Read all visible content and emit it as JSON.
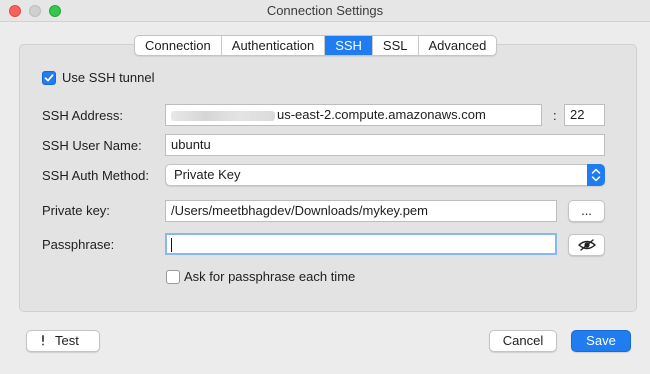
{
  "window": {
    "title": "Connection Settings"
  },
  "tabs": [
    {
      "label": "Connection",
      "active": false
    },
    {
      "label": "Authentication",
      "active": false
    },
    {
      "label": "SSH",
      "active": true
    },
    {
      "label": "SSL",
      "active": false
    },
    {
      "label": "Advanced",
      "active": false
    }
  ],
  "ssh": {
    "use_tunnel_label": "Use SSH tunnel",
    "use_tunnel_checked": true,
    "address_label": "SSH Address:",
    "address_value": "us-east-2.compute.amazonaws.com",
    "port_separator": ":",
    "port_value": "22",
    "username_label": "SSH User Name:",
    "username_value": "ubuntu",
    "auth_method_label": "SSH Auth Method:",
    "auth_method_value": "Private Key",
    "private_key_label": "Private key:",
    "private_key_value": "/Users/meetbhagdev/Downloads/mykey.pem",
    "browse_label": "...",
    "passphrase_label": "Passphrase:",
    "passphrase_value": "",
    "ask_passphrase_label": "Ask for passphrase each time",
    "ask_passphrase_checked": false
  },
  "footer": {
    "test_label": "Test",
    "cancel_label": "Cancel",
    "save_label": "Save"
  },
  "icons": {
    "test": "exclamation-icon",
    "passphrase_toggle": "eye-slash-icon",
    "auth_select": "chevron-up-down-icon"
  },
  "colors": {
    "accent": "#1f7cf1",
    "close": "#fc605c",
    "maximize": "#34c84a"
  }
}
